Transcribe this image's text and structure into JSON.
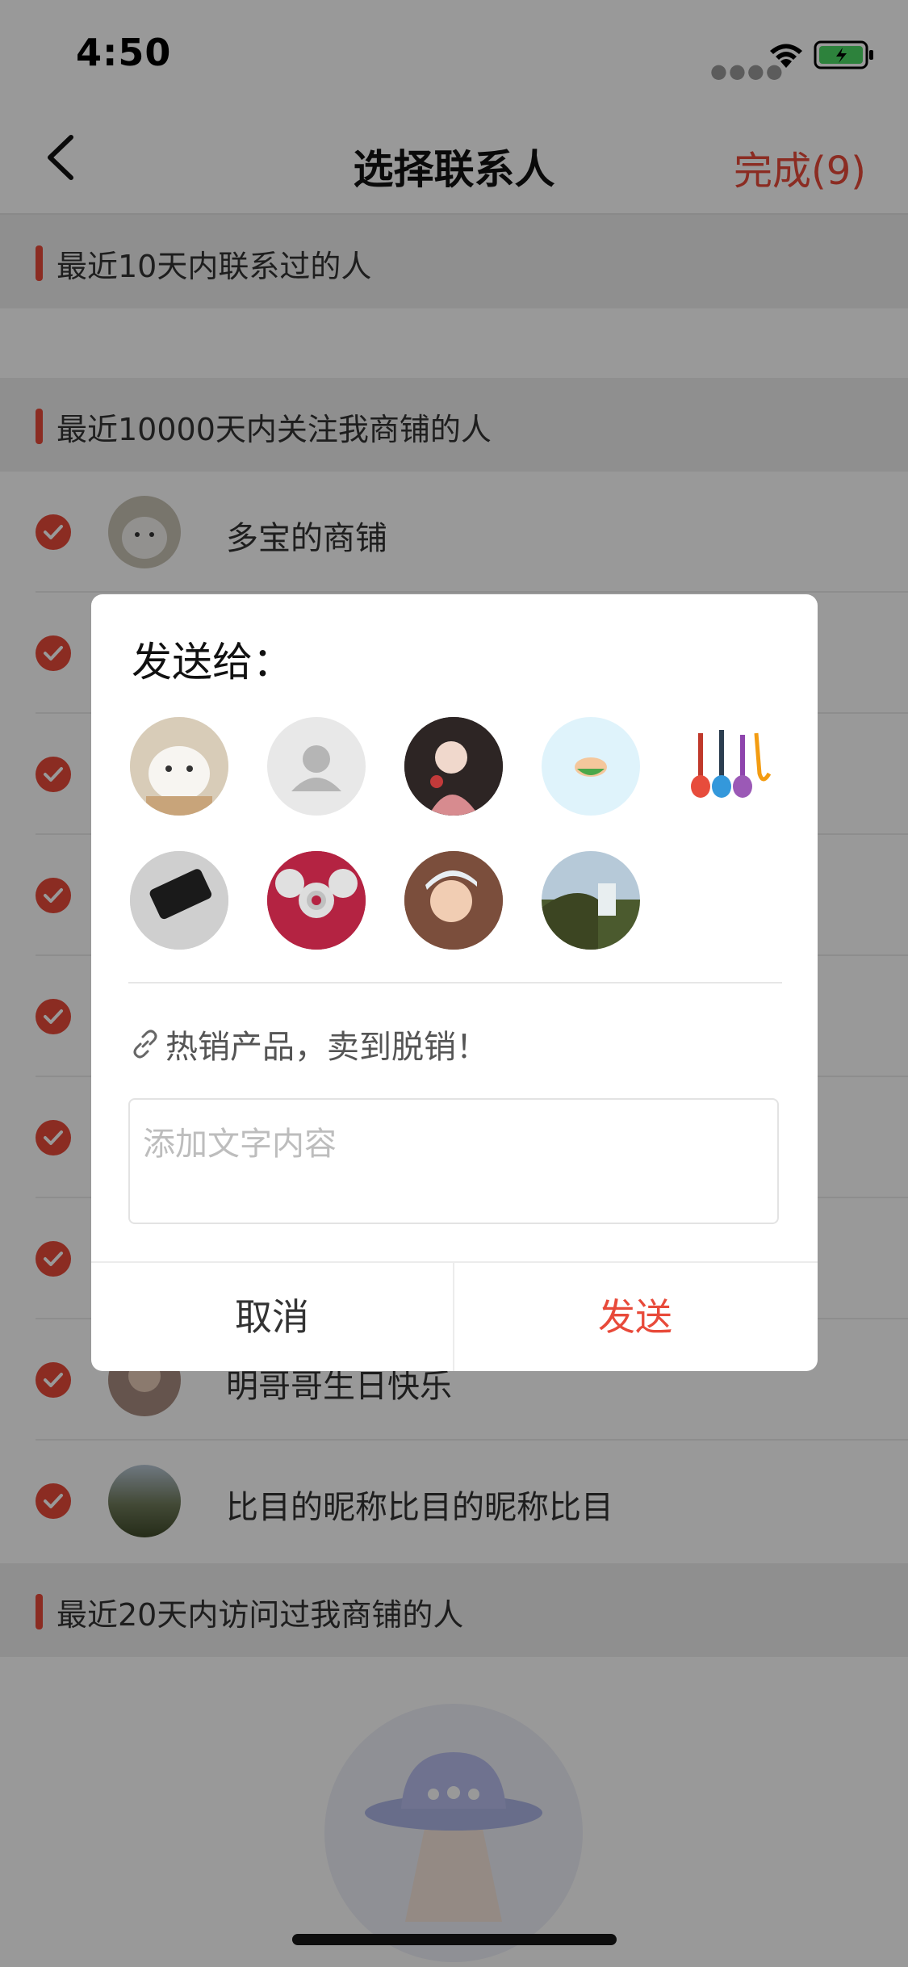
{
  "status_bar": {
    "time": "4:50"
  },
  "nav": {
    "title": "选择联系人",
    "done_label": "完成(9)"
  },
  "sections": [
    {
      "label": "最近10天内联系过的人"
    },
    {
      "label": "最近10000天内关注我商铺的人"
    },
    {
      "label": "最近20天内访问过我商铺的人"
    }
  ],
  "contacts": [
    {
      "name": "多宝的商铺"
    },
    {
      "name": "明哥哥生日快乐"
    },
    {
      "name": "比目的昵称比目的昵称比目"
    }
  ],
  "dialog": {
    "title": "发送给：",
    "recipients_count": 9,
    "share_text": "热销产品，卖到脱销！",
    "input_placeholder": "添加文字内容",
    "input_value": "",
    "cancel_label": "取消",
    "send_label": "发送"
  },
  "colors": {
    "accent": "#e84a3a",
    "overlay": "rgba(0,0,0,0.40)"
  }
}
